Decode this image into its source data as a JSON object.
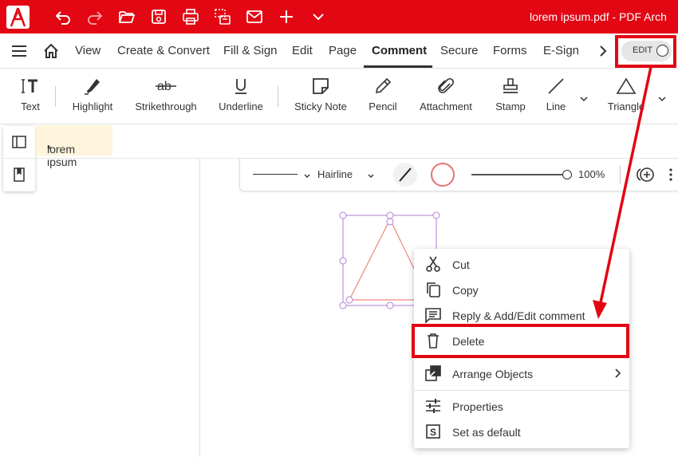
{
  "titlebar": {
    "title": "lorem ipsum.pdf  -  PDF Arch",
    "icons": [
      "undo-icon",
      "redo-icon",
      "open-folder-icon",
      "save-icon",
      "print-icon",
      "scan-icon",
      "mail-icon",
      "plus-icon",
      "chevron-down-icon"
    ],
    "bg": "#e30613"
  },
  "menubar": {
    "items": [
      "View",
      "Create & Convert",
      "Fill & Sign",
      "Edit",
      "Page",
      "Comment",
      "Secure",
      "Forms",
      "E-Sign"
    ],
    "active": "Comment",
    "edit_toggle": "EDIT"
  },
  "toolbar": {
    "tools": [
      "Text",
      "Highlight",
      "Strikethrough",
      "Underline",
      "Sticky Note",
      "Pencil",
      "Attachment",
      "Stamp",
      "Line",
      "Triangle"
    ]
  },
  "document": {
    "tab_label": "lorem ipsum",
    "tab_modified": "*"
  },
  "propbar": {
    "line_style": "Hairline",
    "zoom": "100%",
    "stroke_color": "#e57373"
  },
  "context_menu": {
    "items": [
      "Cut",
      "Copy",
      "Reply & Add/Edit comment",
      "Delete",
      "Arrange Objects",
      "Properties",
      "Set as default"
    ],
    "highlighted": "Delete"
  },
  "annotation": {
    "color": "#e30613"
  }
}
